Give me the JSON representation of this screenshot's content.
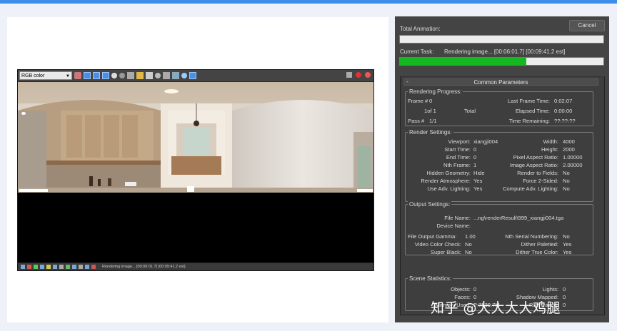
{
  "frame_buffer": {
    "channel_select": "RGB color",
    "status_text": "Rendering image... [00:06:01.7] [00:09:41.2 est]"
  },
  "dialog": {
    "total_animation_label": "Total Animation:",
    "cancel_label": "Cancel",
    "current_task_label": "Current Task:",
    "current_task_value": "Rendering image... [00:06:01.7] [00:09:41.2 est]",
    "total_progress": 0.0,
    "current_progress": 0.62,
    "rollout_title": "Common Parameters",
    "rollout_collapse": "-",
    "rendering_progress": {
      "title": "Rendering Progress:",
      "frame_label": "Frame #",
      "frame_value": "0",
      "last_frame_time_label": "Last Frame Time:",
      "last_frame_time_value": "0:02:07",
      "one_of": "1of 1",
      "total_label": "Total",
      "elapsed_label": "Elapsed Time:",
      "elapsed_value": "0:00:00",
      "pass_label": "Pass #",
      "pass_value": "1/1",
      "time_remaining_label": "Time Remaining:",
      "time_remaining_value": "??:??:??"
    },
    "render_settings": {
      "title": "Render Settings:",
      "viewport_label": "Viewport:",
      "viewport_value": "xiangji004",
      "width_label": "Width:",
      "width_value": "4000",
      "start_time_label": "Start Time:",
      "start_time_value": "0",
      "height_label": "Height:",
      "height_value": "2000",
      "end_time_label": "End Time:",
      "end_time_value": "0",
      "pixel_aspect_label": "Pixel Aspect Ratio:",
      "pixel_aspect_value": "1.00000",
      "nth_frame_label": "Nth Frame:",
      "nth_frame_value": "1",
      "image_aspect_label": "Image Aspect Ratio:",
      "image_aspect_value": "2.00000",
      "hidden_geom_label": "Hidden Geometry:",
      "hidden_geom_value": "Hide",
      "render_fields_label": "Render to Fields:",
      "render_fields_value": "No",
      "render_atmo_label": "Render Atmosphere:",
      "render_atmo_value": "Yes",
      "force_2sided_label": "Force 2-Sided:",
      "force_2sided_value": "No",
      "adv_light_label": "Use Adv. Lighting:",
      "adv_light_value": "Yes",
      "compute_adv_label": "Compute Adv. Lighting:",
      "compute_adv_value": "No"
    },
    "output_settings": {
      "title": "Output Settings:",
      "file_name_label": "File Name:",
      "file_name_value": "...ng\\renderResult\\999_xiangji004.tga",
      "device_name_label": "Device Name:",
      "gamma_label": "File Output Gamma:",
      "gamma_value": "1.00",
      "nth_serial_label": "Nth Serial Numbering:",
      "nth_serial_value": "No",
      "video_check_label": "Video Color Check:",
      "video_check_value": "No",
      "dither_pal_label": "Dither Paletted:",
      "dither_pal_value": "Yes",
      "super_black_label": "Super Black:",
      "super_black_value": "No",
      "dither_true_label": "Dither True Color:",
      "dither_true_value": "Yes"
    },
    "scene_statistics": {
      "title": "Scene Statistics:",
      "objects_label": "Objects:",
      "objects_value": "0",
      "lights_label": "Lights:",
      "lights_value": "0",
      "faces_label": "Faces:",
      "faces_value": "0",
      "shadow_label": "Shadow Mapped:",
      "shadow_value": "0",
      "memory_label": "Memory Used:",
      "memory_value": "P:7539.7M",
      "ray_label": "Ray Traced:",
      "ray_value": "0"
    }
  },
  "watermark": "知乎 @大大大大鸡腿",
  "colors": {
    "progress_green": "#16b81f",
    "accent_blue": "#3c8ee8"
  }
}
